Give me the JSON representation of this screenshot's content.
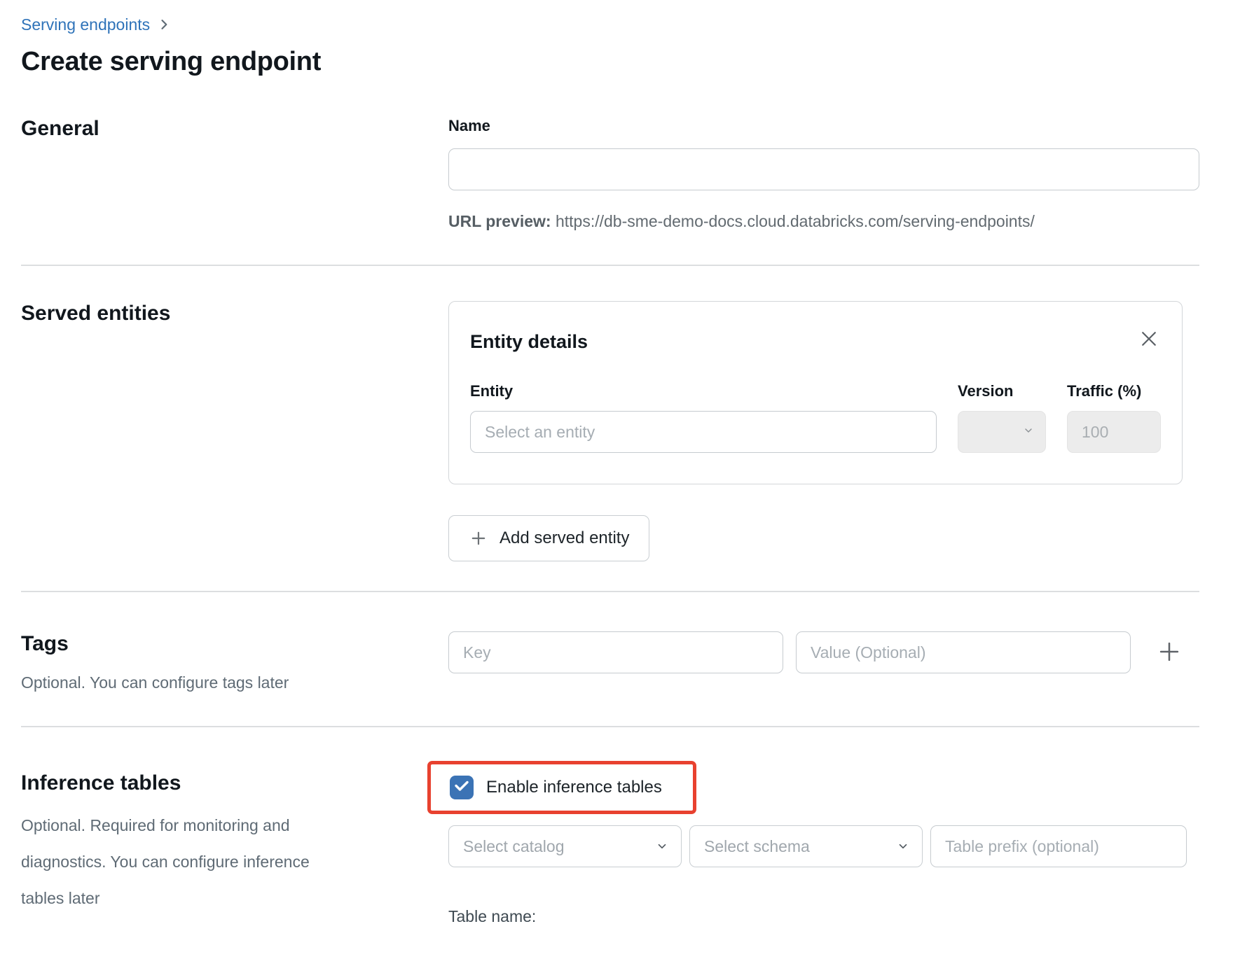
{
  "breadcrumb": {
    "link_label": "Serving endpoints"
  },
  "page_title": "Create serving endpoint",
  "general": {
    "heading": "General",
    "name_label": "Name",
    "name_value": "",
    "url_preview_label": "URL preview:",
    "url_preview_value": "https://db-sme-demo-docs.cloud.databricks.com/serving-endpoints/"
  },
  "served_entities": {
    "heading": "Served entities",
    "card_title": "Entity details",
    "entity_label": "Entity",
    "version_label": "Version",
    "traffic_label": "Traffic (%)",
    "entity_placeholder": "Select an entity",
    "traffic_value": "100",
    "add_button_label": "Add served entity"
  },
  "tags": {
    "heading": "Tags",
    "subtitle": "Optional. You can configure tags later",
    "key_placeholder": "Key",
    "value_placeholder": "Value (Optional)"
  },
  "inference_tables": {
    "heading": "Inference tables",
    "subtitle": "Optional. Required for monitoring and diagnostics. You can configure inference tables later",
    "checkbox_label": "Enable inference tables",
    "checkbox_checked": true,
    "catalog_placeholder": "Select catalog",
    "schema_placeholder": "Select schema",
    "prefix_placeholder": "Table prefix (optional)",
    "table_name_label": "Table name:"
  },
  "colors": {
    "link_blue": "#2f73b9",
    "checkbox_blue": "#3b73b5",
    "annotation_red": "#e8412f"
  }
}
